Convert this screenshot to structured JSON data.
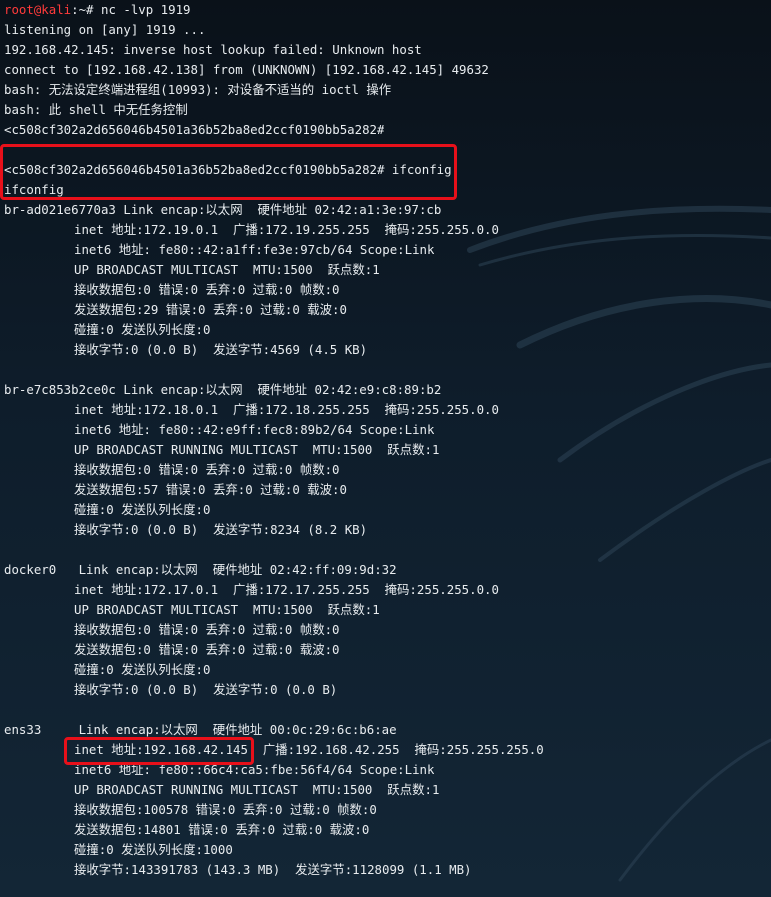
{
  "terminal": {
    "prompt": {
      "user_host": "root@kali",
      "path": ":~#",
      "command": " nc -lvp 1919"
    },
    "lines": [
      "listening on [any] 1919 ...",
      "192.168.42.145: inverse host lookup failed: Unknown host",
      "connect to [192.168.42.138] from (UNKNOWN) [192.168.42.145] 49632",
      "bash: 无法设定终端进程组(10993): 对设备不适当的 ioctl 操作",
      "bash: 此 shell 中无任务控制",
      "<c508cf302a2d656046b4501a36b52ba8ed2ccf0190bb5a282#",
      "",
      "<c508cf302a2d656046b4501a36b52ba8ed2ccf0190bb5a282# ifconfig",
      "ifconfig",
      "br-ad021e6770a3 Link encap:以太网  硬件地址 02:42:a1:3e:97:cb",
      "inet 地址:172.19.0.1  广播:172.19.255.255  掩码:255.255.0.0",
      "inet6 地址: fe80::42:a1ff:fe3e:97cb/64 Scope:Link",
      "UP BROADCAST MULTICAST  MTU:1500  跃点数:1",
      "接收数据包:0 错误:0 丢弃:0 过载:0 帧数:0",
      "发送数据包:29 错误:0 丢弃:0 过载:0 载波:0",
      "碰撞:0 发送队列长度:0",
      "接收字节:0 (0.0 B)  发送字节:4569 (4.5 KB)",
      "",
      "br-e7c853b2ce0c Link encap:以太网  硬件地址 02:42:e9:c8:89:b2",
      "inet 地址:172.18.0.1  广播:172.18.255.255  掩码:255.255.0.0",
      "inet6 地址: fe80::42:e9ff:fec8:89b2/64 Scope:Link",
      "UP BROADCAST RUNNING MULTICAST  MTU:1500  跃点数:1",
      "接收数据包:0 错误:0 丢弃:0 过载:0 帧数:0",
      "发送数据包:57 错误:0 丢弃:0 过载:0 载波:0",
      "碰撞:0 发送队列长度:0",
      "接收字节:0 (0.0 B)  发送字节:8234 (8.2 KB)",
      "",
      "docker0   Link encap:以太网  硬件地址 02:42:ff:09:9d:32",
      "inet 地址:172.17.0.1  广播:172.17.255.255  掩码:255.255.0.0",
      "UP BROADCAST MULTICAST  MTU:1500  跃点数:1",
      "接收数据包:0 错误:0 丢弃:0 过载:0 帧数:0",
      "发送数据包:0 错误:0 丢弃:0 过载:0 载波:0",
      "碰撞:0 发送队列长度:0",
      "接收字节:0 (0.0 B)  发送字节:0 (0.0 B)",
      "",
      "ens33     Link encap:以太网  硬件地址 00:0c:29:6c:b6:ae",
      "inet 地址:192.168.42.145  广播:192.168.42.255  掩码:255.255.255.0",
      "inet6 地址: fe80::66c4:ca5:fbe:56f4/64 Scope:Link",
      "UP BROADCAST RUNNING MULTICAST  MTU:1500  跃点数:1",
      "接收数据包:100578 错误:0 丢弃:0 过载:0 帧数:0",
      "发送数据包:14801 错误:0 丢弃:0 过载:0 载波:0",
      "碰撞:0 发送队列长度:1000",
      "接收字节:143391783 (143.3 MB)  发送字节:1128099 (1.1 MB)"
    ]
  },
  "colors": {
    "prompt_user": "#ff3b3b",
    "text": "#e8ecef",
    "highlight": "#e8101a",
    "background": "#0e1d2b"
  }
}
